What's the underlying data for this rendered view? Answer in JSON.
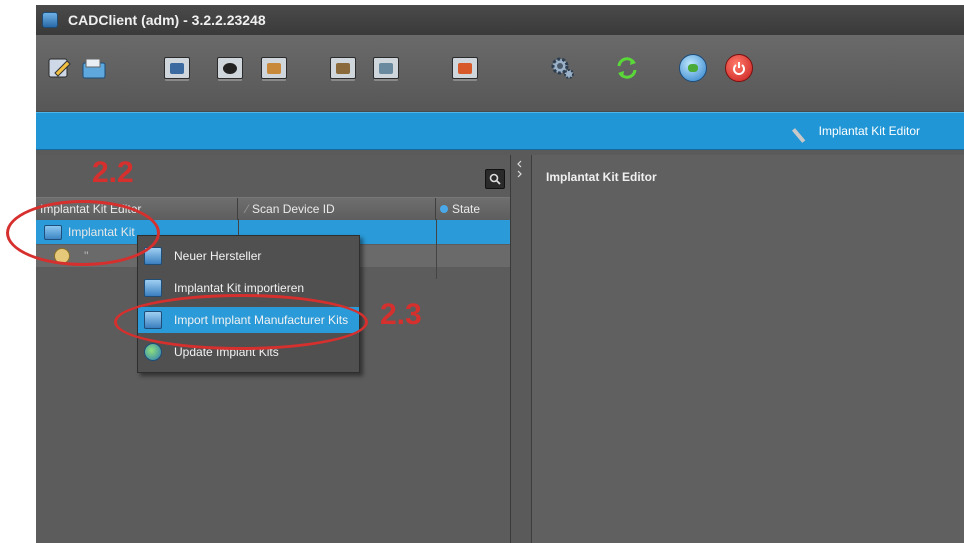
{
  "window": {
    "title": "CADClient (adm) - 3.2.2.23248"
  },
  "toolbar": {
    "icons": [
      "edit-icon",
      "open-folder-icon",
      "monitor-scan-icon",
      "monitor-grid-icon",
      "monitor-user-icon",
      "monitor-model-icon",
      "monitor-settings-icon",
      "monitor-home-icon",
      "settings-gear-icon",
      "sync-arrows-icon",
      "globe-icon",
      "power-icon"
    ]
  },
  "banner": {
    "title": "Implantat Kit Editor"
  },
  "left_panel": {
    "columns": [
      "Implantat Kit Editor",
      "Scan Device ID",
      "State"
    ],
    "rows": [
      {
        "label": "Implantat Kit"
      },
      {
        "label": "''"
      }
    ]
  },
  "right_panel": {
    "title": "Implantat Kit Editor"
  },
  "context_menu": {
    "items": [
      {
        "label": "Neuer Hersteller"
      },
      {
        "label": "Implantat Kit importieren"
      },
      {
        "label": "Import Implant Manufacturer Kits"
      },
      {
        "label": "Update Implant Kits"
      }
    ]
  },
  "annotations": {
    "step_a": "2.2",
    "step_b": "2.3"
  },
  "colors": {
    "accent": "#2096d6",
    "annotation_red": "#d6302e",
    "panel_bg": "#5c5c5c"
  }
}
